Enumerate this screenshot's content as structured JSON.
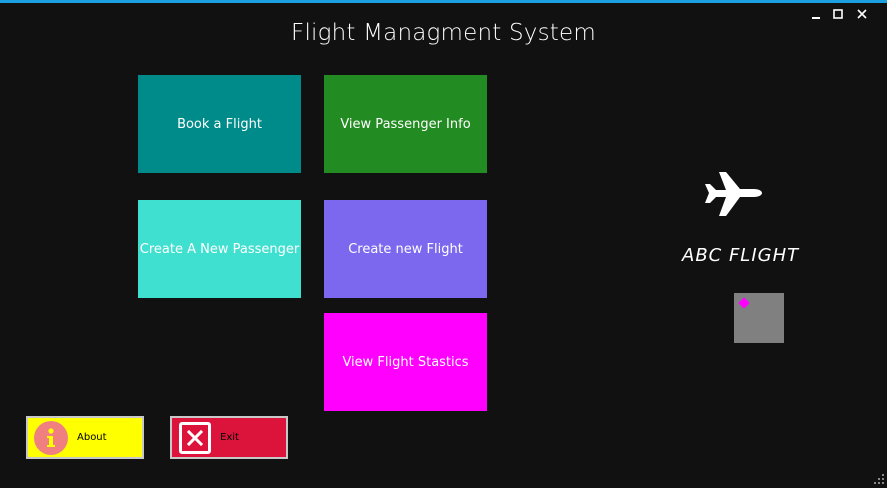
{
  "window": {
    "title": "Flight Managment System",
    "controls": [
      "minimize-icon",
      "maximize-icon",
      "close-icon"
    ]
  },
  "tiles": {
    "book_flight": {
      "label": "Book a Flight",
      "color": "#008b8b"
    },
    "view_passenger": {
      "label": "View Passenger Info",
      "color": "#228b22"
    },
    "create_passenger": {
      "label": "Create A New Passenger",
      "color": "#40e0d0"
    },
    "create_flight": {
      "label": "Create new Flight",
      "color": "#7b68ee"
    },
    "view_stats": {
      "label": "View Flight Stastics",
      "color": "#ff00ff"
    }
  },
  "buttons": {
    "about": {
      "label": "About",
      "color": "#ffff00",
      "icon": "info-icon"
    },
    "exit": {
      "label": "Exit",
      "color": "#dc143c",
      "icon": "close-box-icon"
    }
  },
  "brand": {
    "icon": "airplane-icon",
    "name": "ABC FLIGHT"
  }
}
